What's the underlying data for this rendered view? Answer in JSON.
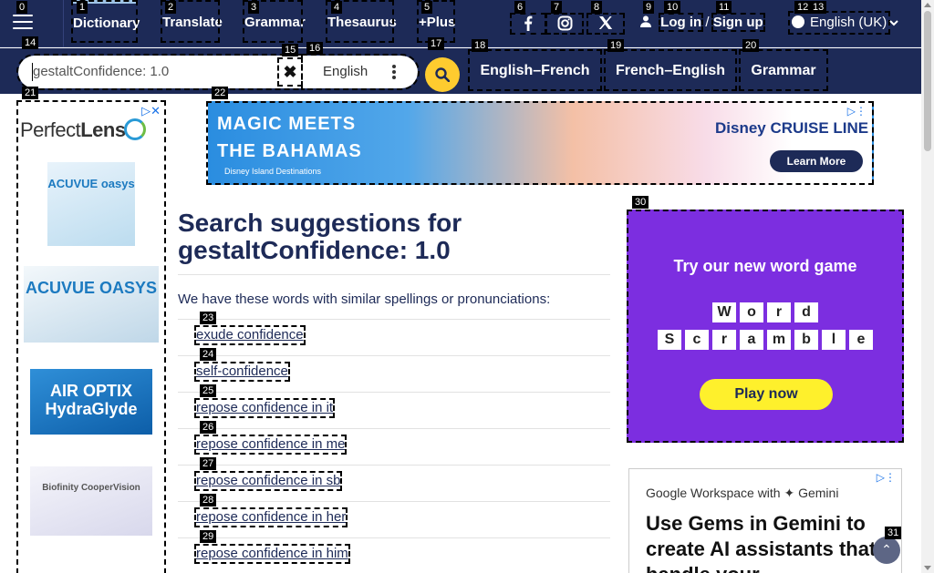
{
  "nav": {
    "items": [
      {
        "label": "Dictionary",
        "badge": "1"
      },
      {
        "label": "Translate",
        "badge": "2"
      },
      {
        "label": "Grammar",
        "badge": "3"
      },
      {
        "label": "Thesaurus",
        "badge": "4"
      },
      {
        "label": "+Plus",
        "badge": "5"
      }
    ],
    "menu_badge": "0",
    "social": [
      {
        "icon": "facebook-icon",
        "badge": "6"
      },
      {
        "icon": "instagram-icon",
        "badge": "7"
      },
      {
        "icon": "x-twitter-icon",
        "badge": "8"
      }
    ],
    "login": {
      "login_label": "Log in",
      "separator": "/",
      "signup_label": "Sign up",
      "badges": [
        "9",
        "10",
        "11"
      ]
    },
    "language": {
      "label": "English (UK)",
      "badges": [
        "12",
        "13"
      ]
    }
  },
  "search": {
    "value": "gestaltConfidence: 1.0",
    "input_badge": "14",
    "clear_badge": "15",
    "dictionary_select": "English",
    "select_badge": "16",
    "submit_badge": "17",
    "quick_links": [
      {
        "label": "English–French",
        "badge": "18"
      },
      {
        "label": "French–English",
        "badge": "19"
      },
      {
        "label": "Grammar",
        "badge": "20"
      }
    ]
  },
  "ads": {
    "left": {
      "badge": "21",
      "brand_a": "Perfect",
      "brand_b": "Lens",
      "products": [
        "ACUVUE oasys",
        "ACUVUE OASYS",
        "AIR OPTIX HydraGlyde",
        "Biofinity CooperVision"
      ]
    },
    "top": {
      "badge": "22",
      "headline_1": "MAGIC MEETS",
      "headline_2": "THE BAHAMAS",
      "subline": "Disney Island Destinations",
      "brand": "Disney CRUISE LINE",
      "cta": "Learn More"
    },
    "word_game": {
      "badge": "30",
      "title": "Try our new word game",
      "row1": [
        "W",
        "o",
        "r",
        "d"
      ],
      "row2": [
        "S",
        "c",
        "r",
        "a",
        "m",
        "b",
        "l",
        "e"
      ],
      "cta": "Play now"
    },
    "google": {
      "line1": "Google Workspace with ✦ Gemini",
      "line2": "Use Gems in Gemini to create AI assistants that handle your"
    }
  },
  "main": {
    "heading_prefix": "Search suggestions for",
    "heading_term": "gestaltConfidence: 1.0",
    "intro": "We have these words with similar spellings or pronunciations:",
    "suggestions": [
      {
        "text": "exude confidence",
        "badge": "23"
      },
      {
        "text": "self-confidence",
        "badge": "24"
      },
      {
        "text": "repose confidence in it",
        "badge": "25"
      },
      {
        "text": "repose confidence in me",
        "badge": "26"
      },
      {
        "text": "repose confidence in sb",
        "badge": "27"
      },
      {
        "text": "repose confidence in her",
        "badge": "28"
      },
      {
        "text": "repose confidence in him",
        "badge": "29"
      }
    ]
  },
  "back_to_top_badge": "31",
  "colors": {
    "nav_bg": "#1d2a57",
    "search_button": "#fecb2f",
    "word_game_bg": "#7c2ee0"
  }
}
